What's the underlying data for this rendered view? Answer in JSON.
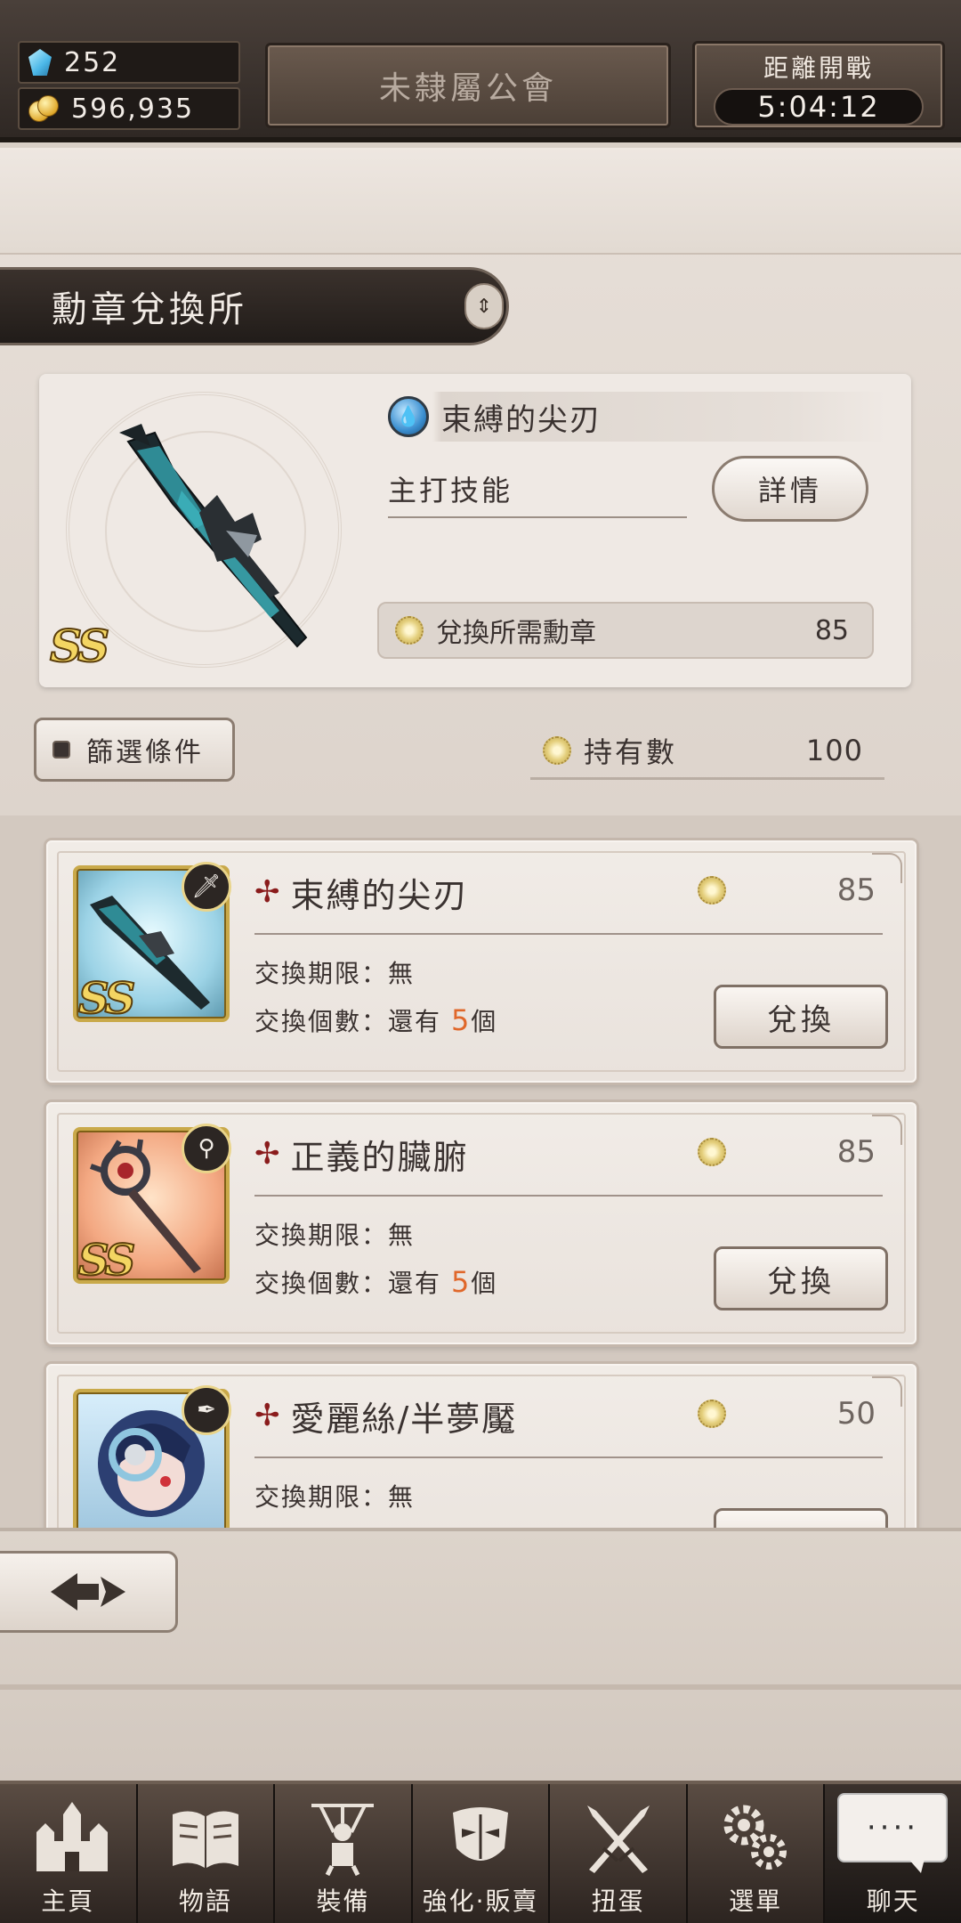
{
  "topbar": {
    "gems": "252",
    "coins": "596,935",
    "guild_name": "未隸屬公會",
    "countdown_label": "距離開戰",
    "countdown_time": "5:04:12"
  },
  "page": {
    "title": "勳章兌換所"
  },
  "featured": {
    "name": "束縛的尖刃",
    "rank": "SS",
    "main_skill_label": "主打技能",
    "detail_button": "詳情",
    "cost_label": "兌換所需勳章",
    "cost_value": "85"
  },
  "filter": {
    "label": "篩選條件"
  },
  "owned": {
    "label": "持有數",
    "value": "100"
  },
  "items": [
    {
      "name": "束縛的尖刃",
      "rank": "SS",
      "cost": "85",
      "period_label": "交換期限：",
      "period_value": "無",
      "count_label": "交換個數：",
      "count_prefix": "還有",
      "count_value": "5",
      "count_suffix": "個",
      "button": "兌換"
    },
    {
      "name": "正義的臟腑",
      "rank": "SS",
      "cost": "85",
      "period_label": "交換期限：",
      "period_value": "無",
      "count_label": "交換個數：",
      "count_prefix": "還有",
      "count_value": "5",
      "count_suffix": "個",
      "button": "兌換"
    },
    {
      "name": "愛麗絲/半夢魘",
      "cost": "50",
      "period_label": "交換期限：",
      "period_value": "無"
    }
  ],
  "nav": {
    "items": [
      {
        "label": "主頁",
        "icon": "castle-icon"
      },
      {
        "label": "物語",
        "icon": "book-icon"
      },
      {
        "label": "裝備",
        "icon": "puppet-icon"
      },
      {
        "label": "強化·販賣",
        "icon": "mask-icon"
      },
      {
        "label": "扭蛋",
        "icon": "swords-icon"
      },
      {
        "label": "選單",
        "icon": "gears-icon"
      },
      {
        "label": "聊天",
        "icon": "chat-bubble-icon"
      }
    ],
    "chat_bubble_text": "····"
  }
}
